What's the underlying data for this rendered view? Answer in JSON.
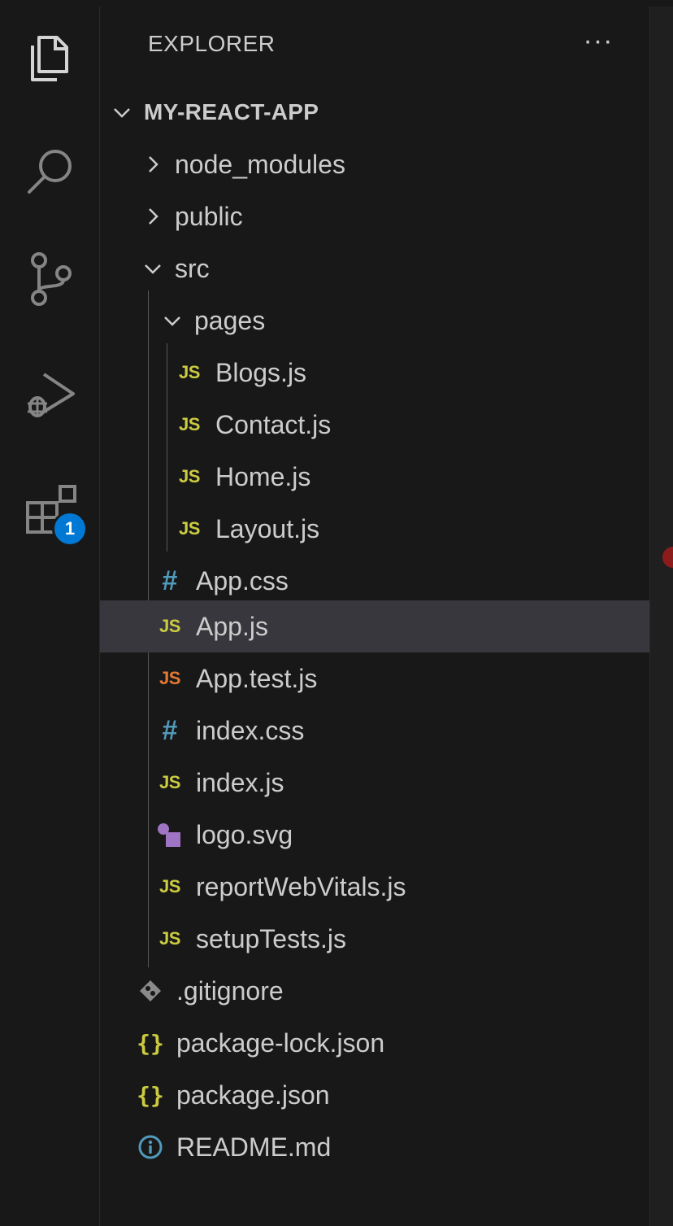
{
  "explorer": {
    "title": "EXPLORER",
    "more_label": "···"
  },
  "activity_bar": {
    "items": [
      {
        "name": "explorer",
        "icon": "files-icon"
      },
      {
        "name": "search",
        "icon": "search-icon"
      },
      {
        "name": "source-control",
        "icon": "source-control-icon"
      },
      {
        "name": "run-and-debug",
        "icon": "run-debug-icon"
      },
      {
        "name": "extensions",
        "icon": "extensions-icon"
      }
    ],
    "extensions_badge": "1"
  },
  "tree": {
    "root": "MY-REACT-APP",
    "node_modules": "node_modules",
    "public": "public",
    "src": "src",
    "pages": "pages",
    "blogs": "Blogs.js",
    "contact": "Contact.js",
    "home": "Home.js",
    "layout": "Layout.js",
    "app_css": "App.css",
    "app_js": "App.js",
    "app_test": "App.test.js",
    "index_css": "index.css",
    "index_js": "index.js",
    "logo": "logo.svg",
    "report": "reportWebVitals.js",
    "setup": "setupTests.js",
    "gitignore": ".gitignore",
    "package_lock": "package-lock.json",
    "package": "package.json",
    "readme": "README.md",
    "selected": "App.js"
  },
  "icon_labels": {
    "js": "JS",
    "css": "#",
    "json": "{}"
  },
  "colors": {
    "background": "#181818",
    "selected_row": "#37373d",
    "js_icon": "#cbcb41",
    "test_icon": "#e37933",
    "css_icon": "#519aba",
    "svg_icon": "#a074c4",
    "badge": "#0078d4"
  }
}
